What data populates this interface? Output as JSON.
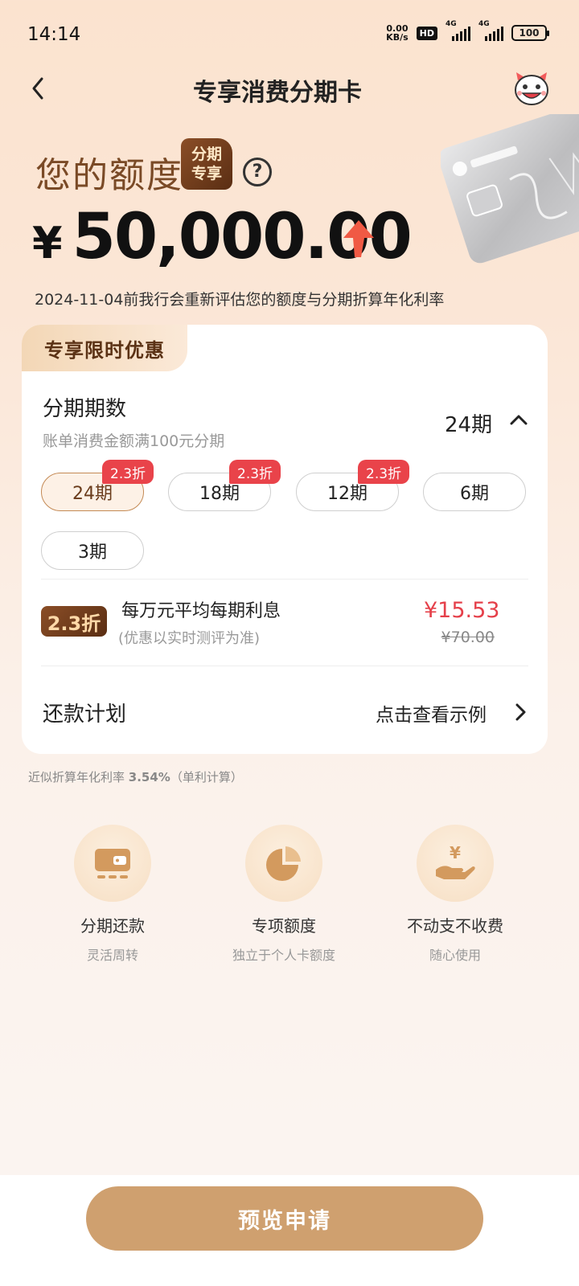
{
  "status_bar": {
    "time": "14:14",
    "net_speed_value": "0.00",
    "net_speed_unit": "KB/s",
    "hd": "HD",
    "network_1": "4G",
    "network_2": "4G",
    "battery": "100"
  },
  "header": {
    "title": "专享消费分期卡"
  },
  "hero": {
    "quota_label": "您的额度",
    "badge_line1": "分期",
    "badge_line2": "专享",
    "help": "?",
    "currency": "¥",
    "amount": "50,000.00",
    "notice": "2024-11-04前我行会重新评估您的额度与分期折算年化利率"
  },
  "panel": {
    "promo_tab": "专享限时优惠",
    "term_title": "分期期数",
    "term_sub": "账单消费金额满100元分期",
    "term_value": "24期",
    "options": [
      {
        "label": "24期",
        "tag": "2.3折",
        "selected": true
      },
      {
        "label": "18期",
        "tag": "2.3折",
        "selected": false
      },
      {
        "label": "12期",
        "tag": "2.3折",
        "selected": false
      },
      {
        "label": "6期",
        "tag": "",
        "selected": false
      },
      {
        "label": "3期",
        "tag": "",
        "selected": false
      }
    ],
    "rate_badge": "2.3折",
    "interest_title": "每万元平均每期利息",
    "interest_note": "(优惠以实时测评为准)",
    "price_now": "¥15.53",
    "price_old": "¥70.00",
    "plan_label": "还款计划",
    "plan_link": "点击查看示例"
  },
  "apr": {
    "prefix": "近似折算年化利率 ",
    "value": "3.54%",
    "suffix": "（单利计算）"
  },
  "features": [
    {
      "title": "分期还款",
      "subtitle": "灵活周转",
      "icon": "wallet-icon"
    },
    {
      "title": "专项额度",
      "subtitle": "独立于个人卡额度",
      "icon": "pie-chart-icon"
    },
    {
      "title": "不动支不收费",
      "subtitle": "随心使用",
      "icon": "hand-coin-icon"
    }
  ],
  "footer": {
    "apply": "预览申请"
  },
  "colors": {
    "accent_brown": "#7a4a26",
    "badge_dark": "#5a2e13",
    "price_red": "#e5404a",
    "button": "#cfa06f"
  }
}
